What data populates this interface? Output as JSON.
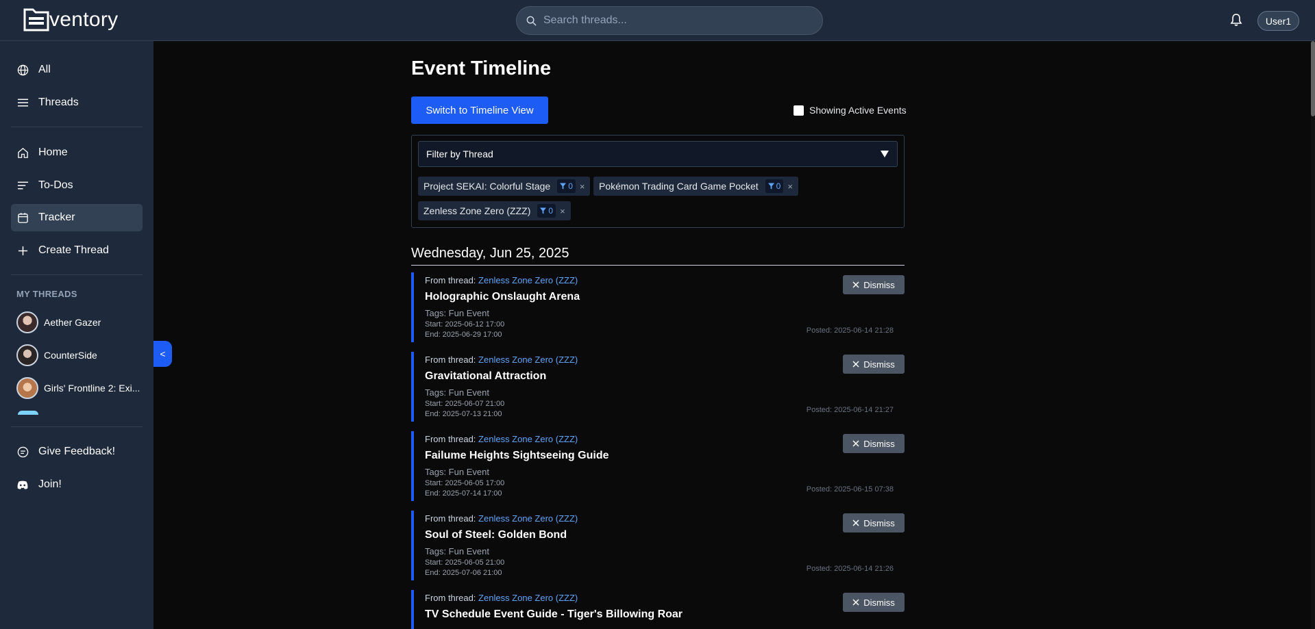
{
  "header": {
    "logo_text": "ventory",
    "search_placeholder": "Search threads...",
    "user_label": "User1"
  },
  "sidebar": {
    "items": [
      {
        "label": "All",
        "icon": "globe-icon"
      },
      {
        "label": "Threads",
        "icon": "menu-icon"
      },
      {
        "label": "Home",
        "icon": "home-icon"
      },
      {
        "label": "To-Dos",
        "icon": "list-icon"
      },
      {
        "label": "Tracker",
        "icon": "calendar-icon",
        "active": true
      },
      {
        "label": "Create Thread",
        "icon": "plus-icon"
      }
    ],
    "section_label": "MY THREADS",
    "threads": [
      {
        "label": "Aether Gazer"
      },
      {
        "label": "CounterSide"
      },
      {
        "label": "Girls' Frontline 2: Exi..."
      }
    ],
    "footer_items": [
      {
        "label": "Give Feedback!",
        "icon": "feedback-icon"
      },
      {
        "label": "Join!",
        "icon": "discord-icon"
      }
    ],
    "collapse_label": "<"
  },
  "main": {
    "title": "Event Timeline",
    "switch_button": "Switch to Timeline View",
    "active_toggle_label": "Showing Active Events",
    "filter_placeholder": "Filter by Thread",
    "chips": [
      {
        "label": "Project SEKAI: Colorful Stage",
        "count": "0"
      },
      {
        "label": "Pokémon Trading Card Game Pocket",
        "count": "0"
      },
      {
        "label": "Zenless Zone Zero (ZZZ)",
        "count": "0"
      }
    ],
    "date_heading": "Wednesday, Jun 25, 2025",
    "from_prefix": "From thread:",
    "dismiss_label": "Dismiss",
    "events": [
      {
        "thread": "Zenless Zone Zero (ZZZ)",
        "title": "Holographic Onslaught Arena",
        "tags": "Tags: Fun Event",
        "start": "Start: 2025-06-12 17:00",
        "end": "End: 2025-06-29 17:00",
        "posted": "Posted: 2025-06-14 21:28"
      },
      {
        "thread": "Zenless Zone Zero (ZZZ)",
        "title": "Gravitational Attraction",
        "tags": "Tags: Fun Event",
        "start": "Start: 2025-06-07 21:00",
        "end": "End: 2025-07-13 21:00",
        "posted": "Posted: 2025-06-14 21:27"
      },
      {
        "thread": "Zenless Zone Zero (ZZZ)",
        "title": "Failume Heights Sightseeing Guide",
        "tags": "Tags: Fun Event",
        "start": "Start: 2025-06-05 17:00",
        "end": "End: 2025-07-14 17:00",
        "posted": "Posted: 2025-06-15 07:38"
      },
      {
        "thread": "Zenless Zone Zero (ZZZ)",
        "title": "Soul of Steel: Golden Bond",
        "tags": "Tags: Fun Event",
        "start": "Start: 2025-06-05 21:00",
        "end": "End: 2025-07-06 21:00",
        "posted": "Posted: 2025-06-14 21:26"
      },
      {
        "thread": "Zenless Zone Zero (ZZZ)",
        "title": "TV Schedule Event Guide - Tiger's Billowing Roar",
        "tags": "",
        "start": "",
        "end": "",
        "posted": ""
      }
    ]
  },
  "colors": {
    "accent": "#1d5cf5",
    "link": "#60a5fa",
    "sidebar_bg": "#1e293b",
    "main_bg": "#0a0a0a"
  }
}
